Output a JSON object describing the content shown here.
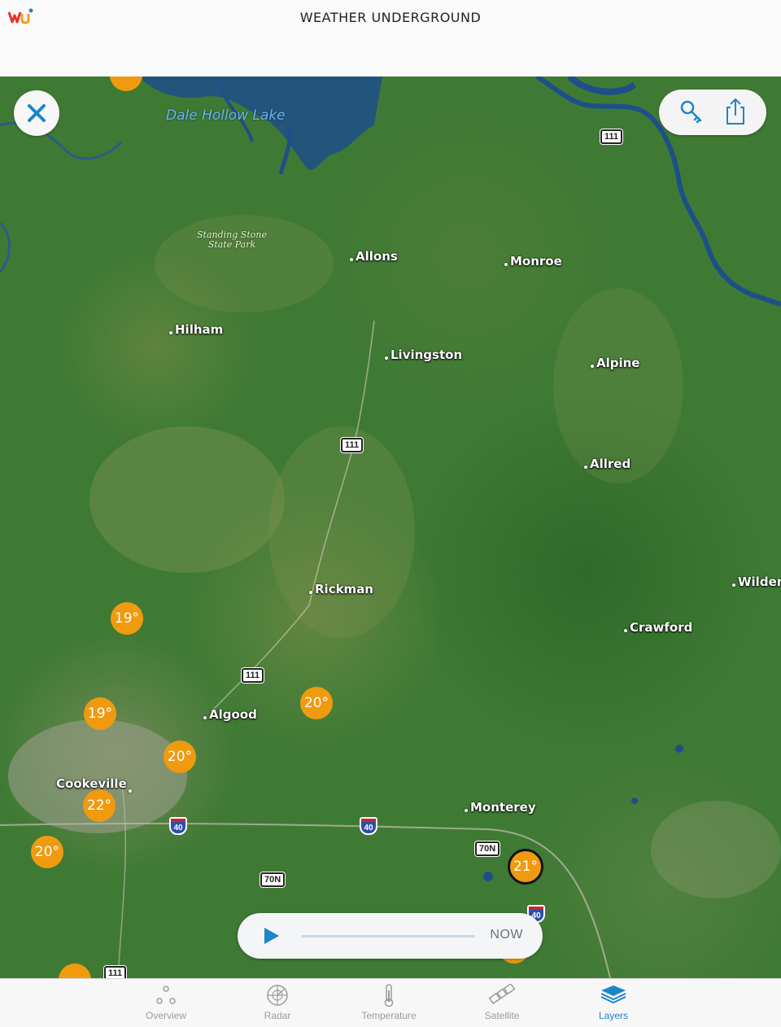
{
  "header": {
    "title": "WEATHER UNDERGROUND",
    "logo_text": "wu"
  },
  "map": {
    "lake_label": "Dale Hollow Lake",
    "park_label_1": "Standing Stone",
    "park_label_2": "State Park",
    "places": {
      "allons": "Allons",
      "monroe": "Monroe",
      "hilham": "Hilham",
      "livingston": "Livingston",
      "alpine": "Alpine",
      "allred": "Allred",
      "wilder": "Wilder",
      "rickman": "Rickman",
      "crawford": "Crawford",
      "algood": "Algood",
      "cookeville": "Cookeville",
      "monterey": "Monterey"
    },
    "temps": {
      "t1": "19°",
      "t2": "19°",
      "t3": "20°",
      "t4": "20°",
      "t5": "22°",
      "t6": "20°",
      "t7": "21°"
    },
    "shields": {
      "us111_a": "111",
      "us111_b": "111",
      "us111_c": "111",
      "us111_d": "111",
      "us70n_a": "70N",
      "us70n_b": "70N",
      "i40_a": "40",
      "i40_b": "40",
      "i40_c": "40"
    }
  },
  "controls": {
    "close_icon": "close-icon",
    "legend_icon": "key-icon",
    "share_icon": "share-icon"
  },
  "player": {
    "play_icon": "play-icon",
    "now_label": "NOW"
  },
  "tabs": [
    {
      "label": "Overview",
      "icon": "overview-icon"
    },
    {
      "label": "Radar",
      "icon": "radar-icon"
    },
    {
      "label": "Temperature",
      "icon": "thermometer-icon"
    },
    {
      "label": "Satellite",
      "icon": "satellite-icon"
    },
    {
      "label": "Layers",
      "icon": "layers-icon",
      "active": true
    }
  ],
  "colors": {
    "accent": "#1b86c8",
    "temp_marker": "#f09a10",
    "map_forest": "#3f7a34",
    "water": "#1f4f8a"
  }
}
